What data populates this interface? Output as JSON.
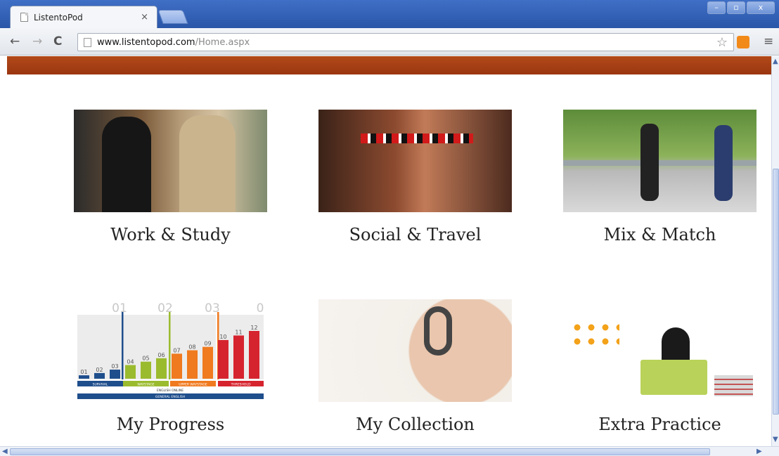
{
  "browser": {
    "tab_title": "ListentoPod",
    "tab_close": "×",
    "url_host": "www.listentopod.com",
    "url_path": "/Home.aspx",
    "window_buttons": {
      "minimize": "–",
      "restore": "▫",
      "close": "x"
    }
  },
  "tiles": [
    {
      "label": "Work & Study"
    },
    {
      "label": "Social & Travel"
    },
    {
      "label": "Mix & Match"
    },
    {
      "label": "My Progress"
    },
    {
      "label": "My Collection"
    },
    {
      "label": "Extra Practice"
    }
  ],
  "progress_chart": {
    "columns": [
      "01",
      "02",
      "03",
      "0"
    ],
    "bars": [
      "01",
      "02",
      "03",
      "04",
      "05",
      "06",
      "07",
      "08",
      "09",
      "10",
      "11",
      "12"
    ],
    "bar_values": [
      3,
      5,
      8,
      12,
      15,
      18,
      22,
      25,
      28,
      34,
      38,
      42
    ],
    "bar_colors": [
      "#1f4e8c",
      "#1f4e8c",
      "#1f4e8c",
      "#9bbb2e",
      "#9bbb2e",
      "#9bbb2e",
      "#f07a1f",
      "#f07a1f",
      "#f07a1f",
      "#d6242f",
      "#d6242f",
      "#d6242f"
    ],
    "levels": [
      "SURVIVAL",
      "WAYSTAGE",
      "UPPER WAYSTAGE",
      "THRESHOLD"
    ],
    "sub_label": "ENGLISH ONLINE",
    "bottom_label": "GENERAL ENGLISH"
  },
  "colors": {
    "banner": "#a83f14",
    "chrome_blue": "#2a56a8"
  }
}
